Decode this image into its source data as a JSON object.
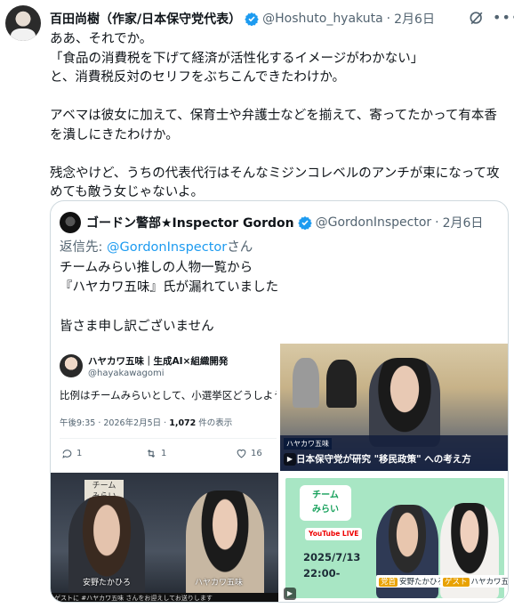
{
  "post": {
    "author_name": "百田尚樹（作家/日本保守党代表）",
    "handle": "@Hoshuto_hyakuta",
    "separator": "·",
    "date": "2月6日",
    "body": "ああ、それでか。\n「食品の消費税を下げて経済が活性化するイメージがわかない」\nと、消費税反対のセリフをぶちこんできたわけか。\n\nアベマは彼女に加えて、保育士や弁護士などを揃えて、寄ってたかって有本香を潰しにきたわけか。\n\n残念やけど、うちの代表代行はそんなミジンコレベルのアンチが束になって攻めても敵う女じゃないよ。"
  },
  "quote": {
    "author_name": "ゴードン警部★Inspector Gordon",
    "handle": "@GordonInspector",
    "separator": "·",
    "date": "2月6日",
    "reply_prefix": "返信先: ",
    "reply_mention": "@GordonInspector",
    "reply_suffix": "さん",
    "body": "チームみらい推しの人物一覧から\n『ハヤカワ五味』氏が漏れていました\n\n皆さま申し訳ございません"
  },
  "media": {
    "tweet_card": {
      "name": "ハヤカワ五味｜生成AI×組織開発",
      "handle": "@hayakawagomi",
      "text": "比例はチームみらいとして、小選挙区どうしよう",
      "meta_time": "午後9:35 · 2026年2月5日 · ",
      "meta_views": "1,072",
      "meta_views_suffix": " 件の表示",
      "reply_count": "1",
      "retweet_count": "1",
      "like_count": "16"
    },
    "tv_caption": {
      "name_tag": "ハヤカワ五味",
      "title": "日本保守党が研究 \"移民政策\" への考え方"
    },
    "studio": {
      "sign": "チーム\nみらい",
      "left_label": "安野たかひろ",
      "right_label": "ハヤカワ五味",
      "ticker": "ゲストに #ハヤカワ五味 さんをお迎えしてお送りします"
    },
    "poster": {
      "logo": "チーム\nみらい",
      "yt": "YouTube LIVE",
      "when": "2025/7/13\n22:00-",
      "left_tag_key": "党首",
      "left_tag": "安野たかひろ",
      "right_tag_key": "ゲスト",
      "right_tag": "ハヤカワ五味"
    }
  },
  "colors": {
    "verified": "#1d9bf0",
    "text": "#0f1419",
    "secondary": "#536471",
    "border": "#cfd9de"
  }
}
